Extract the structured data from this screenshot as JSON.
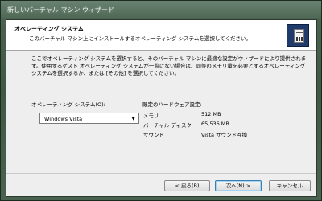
{
  "window": {
    "title": "新しいバーチャル マシン ウィザード"
  },
  "header": {
    "title": "オペレーティング システム",
    "description": "このバーチャル マシン上にインストールするオペレーティング システムを選択してください。"
  },
  "intro": {
    "text": "ここでオペレーティング システムを選択すると、そのバーチャル マシンに最適な設定がウィザードにより提供されます。使用するゲスト オペレーティング システムが一覧にない場合は、同等のメモリ量を必要とするオペレーティング システムを選択するか、または [その他] を選択してください。"
  },
  "os": {
    "label": "オペレーティング システム(O):",
    "selected": "Windows Vista"
  },
  "hardware": {
    "title": "既定のハードウェア設定:",
    "rows": [
      {
        "label": "メモリ",
        "value": "512 MB"
      },
      {
        "label": "バーチャル ディスク",
        "value": "65,536 MB"
      },
      {
        "label": "サウンド",
        "value": "Vista サウンド互換"
      }
    ]
  },
  "buttons": {
    "back": "< 戻る(B)",
    "next": "次へ(N) >",
    "cancel": "キャンセル"
  },
  "icons": {
    "wizard": "virtual-machine-document-icon",
    "dropdown": "chevron-down-icon"
  }
}
